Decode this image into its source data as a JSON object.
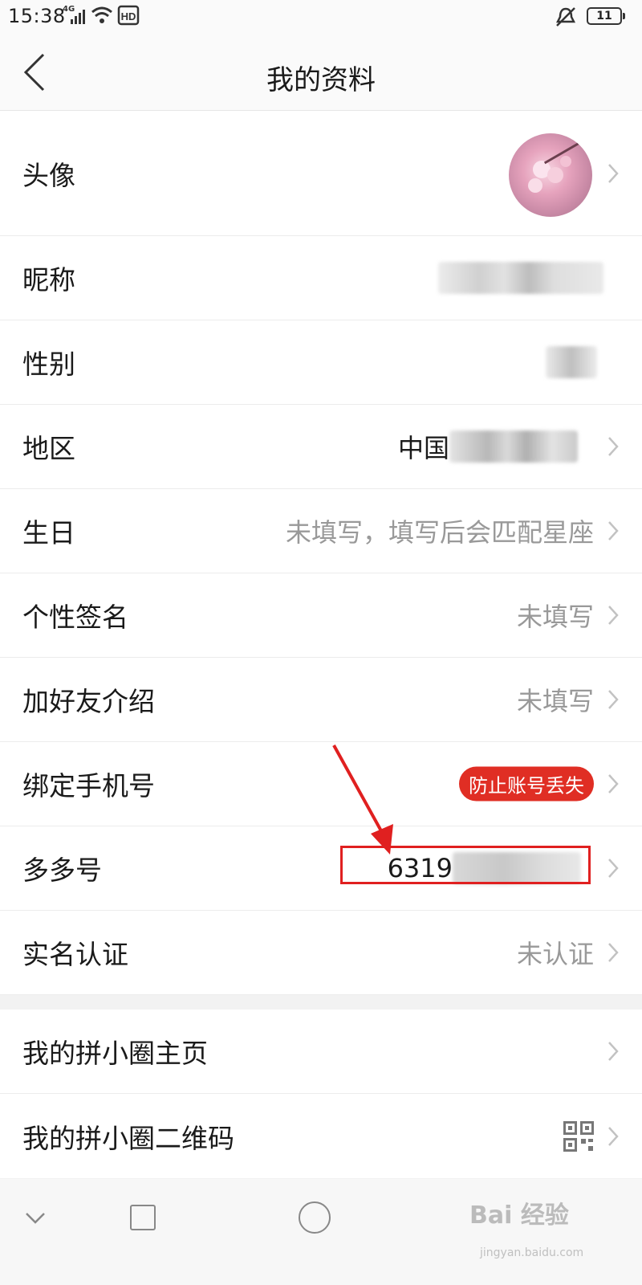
{
  "status_bar": {
    "time": "15:38",
    "network": "4G",
    "hd": "HD",
    "battery": "11"
  },
  "nav": {
    "title": "我的资料"
  },
  "profile_rows": [
    {
      "label": "头像"
    },
    {
      "label": "昵称"
    },
    {
      "label": "性别"
    },
    {
      "label": "地区",
      "value": "中国"
    },
    {
      "label": "生日",
      "value": "未填写，填写后会匹配星座"
    },
    {
      "label": "个性签名",
      "value": "未填写"
    },
    {
      "label": "加好友介绍",
      "value": "未填写"
    },
    {
      "label": "绑定手机号",
      "badge": "防止账号丢失"
    },
    {
      "label": "多多号",
      "value": "6319"
    },
    {
      "label": "实名认证",
      "value": "未认证"
    }
  ],
  "extra_rows": [
    {
      "label": "我的拼小圈主页"
    },
    {
      "label": "我的拼小圈二维码",
      "icon": "qr-code-icon"
    }
  ],
  "watermark": {
    "logo": "Bai 经验",
    "url": "jingyan.baidu.com"
  },
  "colors": {
    "accent_red": "#e02e24",
    "annotation_red": "#e02020",
    "secondary_text": "#999999"
  }
}
